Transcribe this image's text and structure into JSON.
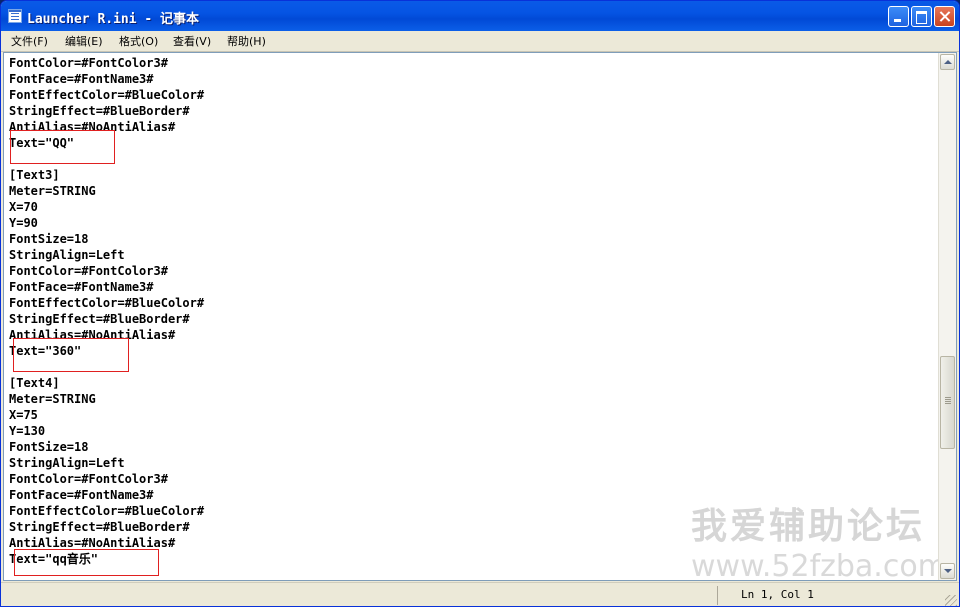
{
  "window": {
    "title": "Launcher R.ini - 记事本"
  },
  "menu": [
    {
      "label": "文件(F)"
    },
    {
      "label": "编辑(E)"
    },
    {
      "label": "格式(O)"
    },
    {
      "label": "查看(V)"
    },
    {
      "label": "帮助(H)"
    }
  ],
  "editor": {
    "lines": [
      "FontColor=#FontColor3#",
      "FontFace=#FontName3#",
      "FontEffectColor=#BlueColor#",
      "StringEffect=#BlueBorder#",
      "AntiAlias=#NoAntiAlias#",
      "Text=\"QQ\"",
      "",
      "[Text3]",
      "Meter=STRING",
      "X=70",
      "Y=90",
      "FontSize=18",
      "StringAlign=Left",
      "FontColor=#FontColor3#",
      "FontFace=#FontName3#",
      "FontEffectColor=#BlueColor#",
      "StringEffect=#BlueBorder#",
      "AntiAlias=#NoAntiAlias#",
      "Text=\"360\"",
      "",
      "[Text4]",
      "Meter=STRING",
      "X=75",
      "Y=130",
      "FontSize=18",
      "StringAlign=Left",
      "FontColor=#FontColor3#",
      "FontFace=#FontName3#",
      "FontEffectColor=#BlueColor#",
      "StringEffect=#BlueBorder#",
      "AntiAlias=#NoAntiAlias#",
      "Text=\"qq音乐\""
    ]
  },
  "watermark": {
    "title": "我爱辅助论坛",
    "url": "www.52fzba.com"
  },
  "status": {
    "position": "Ln 1, Col 1"
  },
  "colors": {
    "titlebar": "#0554e3",
    "highlight_box": "#e02020"
  }
}
